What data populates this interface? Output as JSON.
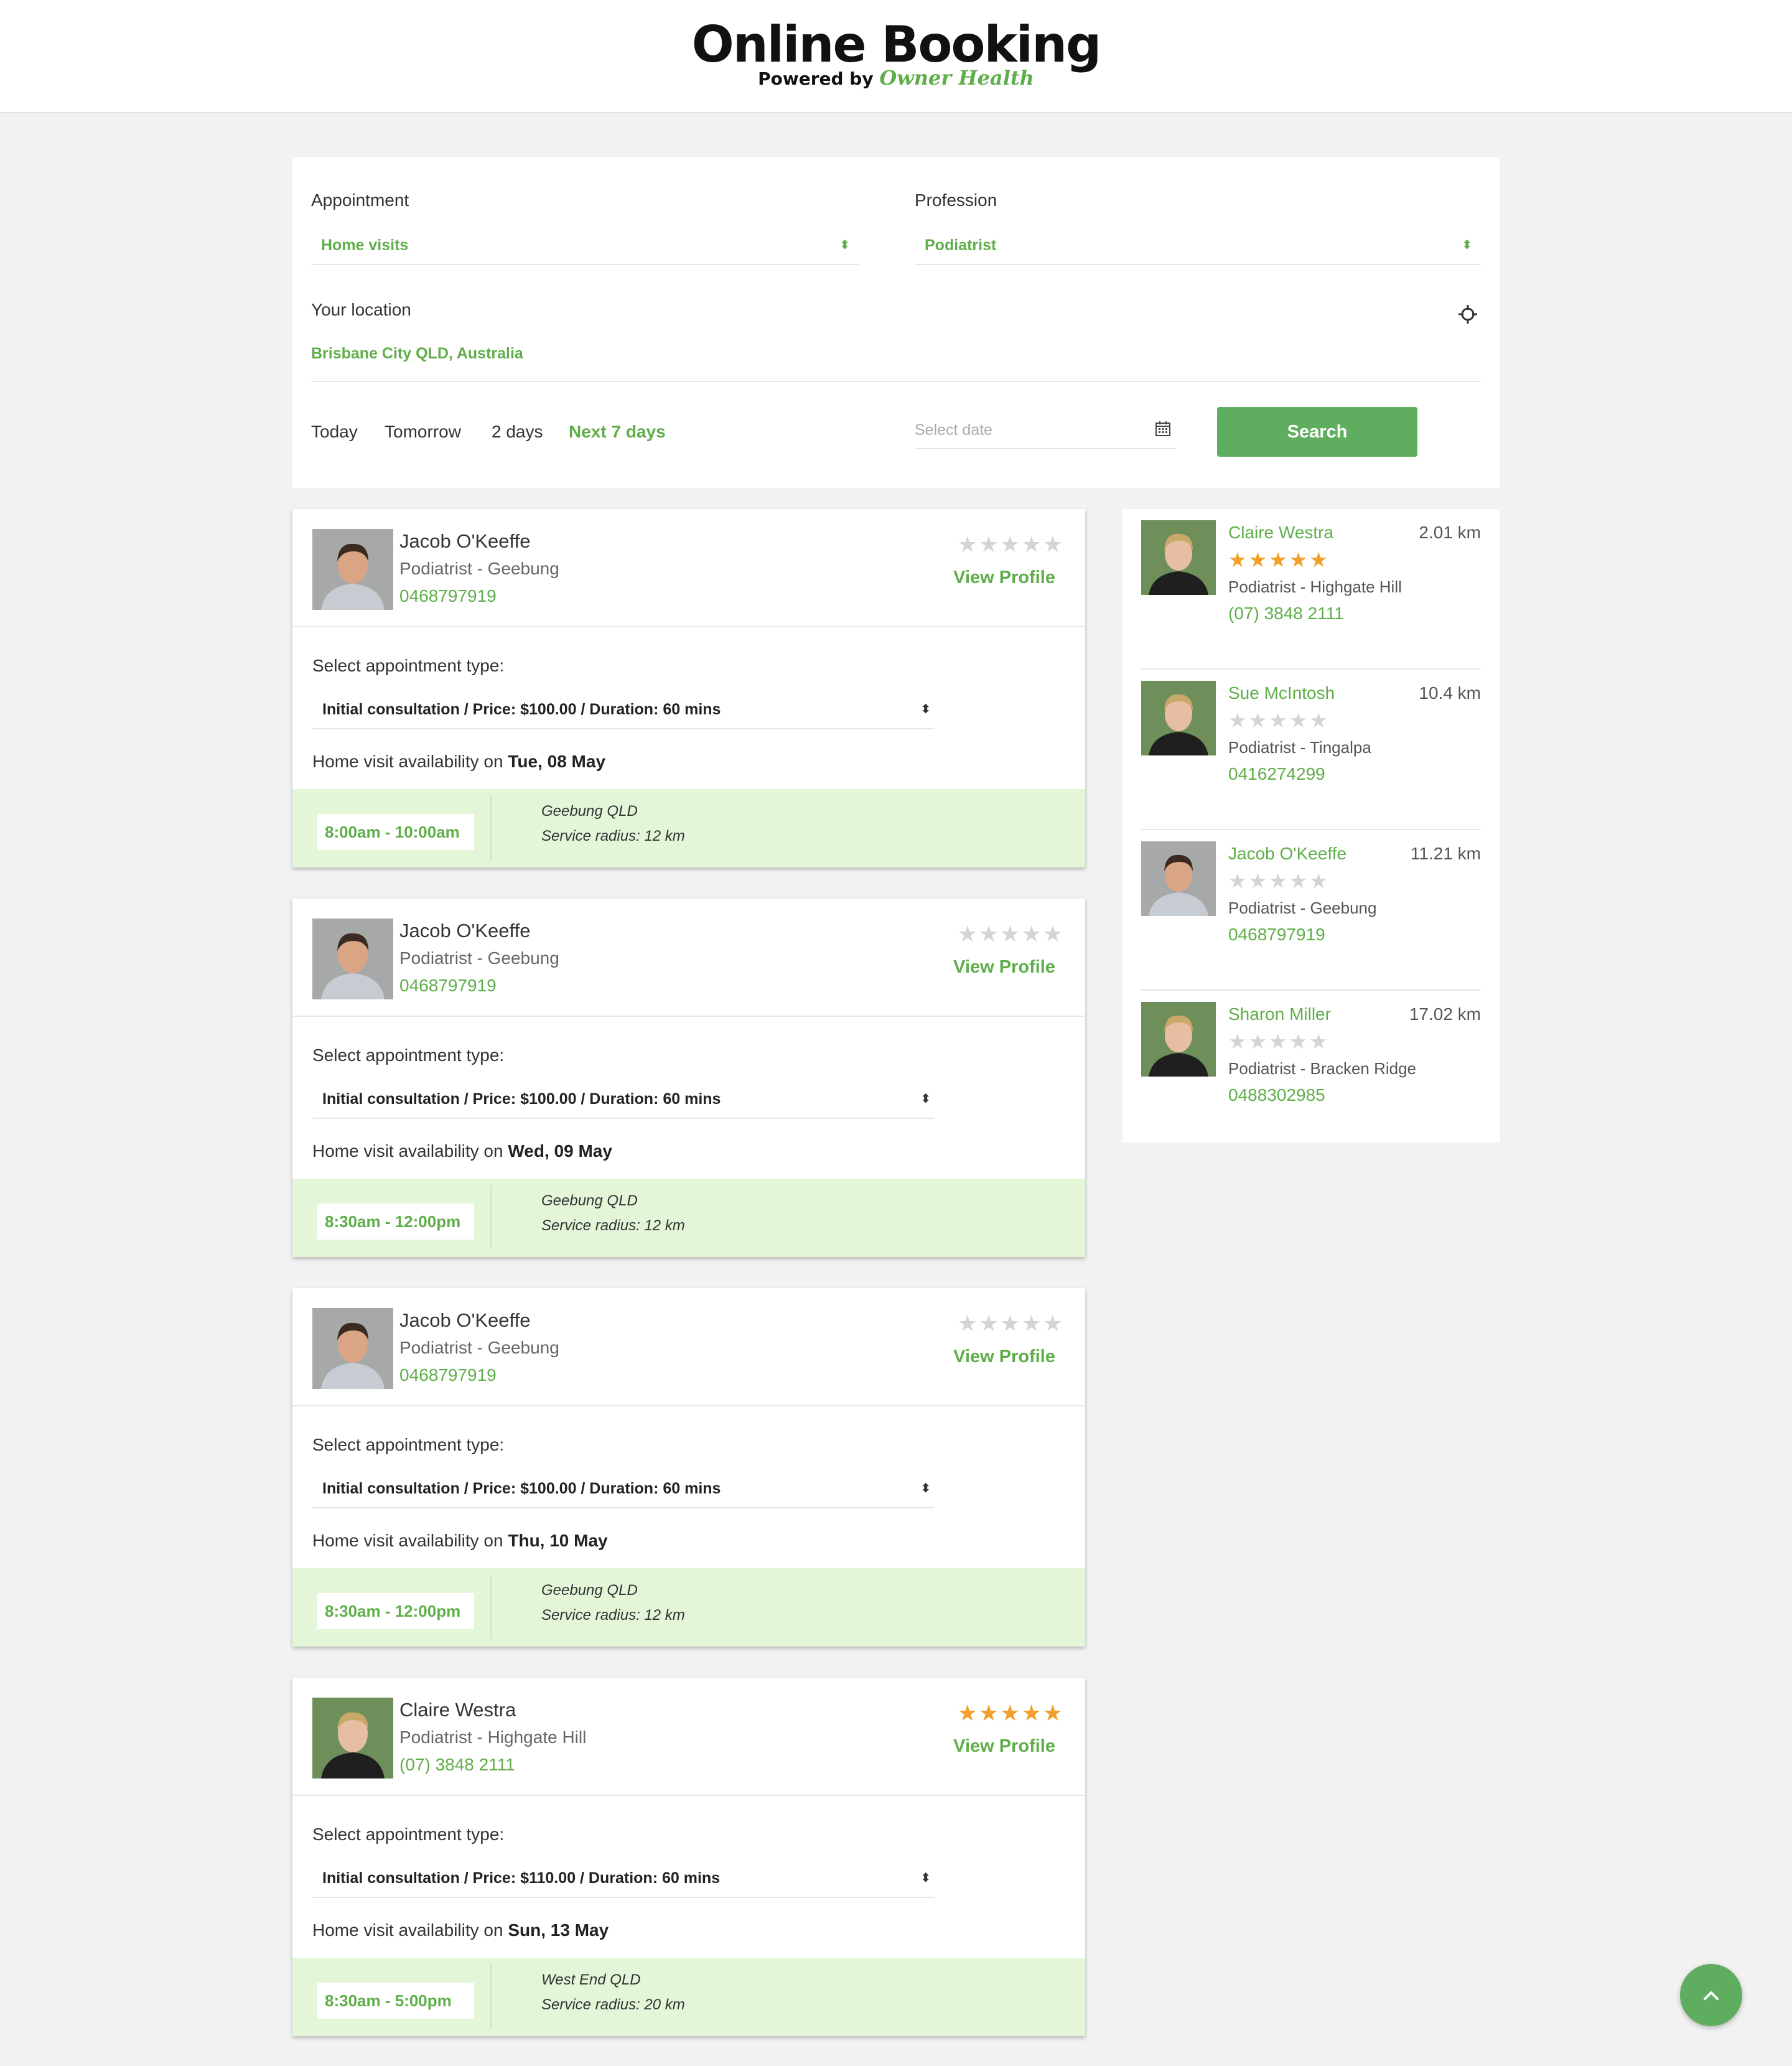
{
  "header": {
    "title": "Online Booking",
    "powered_by": "Powered by",
    "brand": "Owner Health"
  },
  "search": {
    "appointment_label": "Appointment",
    "appointment_value": "Home visits",
    "profession_label": "Profession",
    "profession_value": "Podiatrist",
    "location_label": "Your location",
    "location_value": "Brisbane City QLD, Australia",
    "ranges": [
      "Today",
      "Tomorrow",
      "2 days",
      "Next 7 days"
    ],
    "active_range": "Next 7 days",
    "date_placeholder": "Select date",
    "search_button": "Search"
  },
  "colors": {
    "accent": "#5fae4a",
    "button": "#5fae5f",
    "slot_band": "#e3f6d8",
    "star_on": "#f2a02b",
    "star_off": "#d4d4d4"
  },
  "results": [
    {
      "name": "Jacob O'Keeffe",
      "subtitle": "Podiatrist - Geebung",
      "phone": "0468797919",
      "rating": 0,
      "view_profile": "View Profile",
      "appt_label": "Select appointment type:",
      "appt_type": "Initial consultation / Price: $100.00 / Duration: 60 mins",
      "availability_prefix": "Home visit availability on",
      "availability_date": "Tue, 08 May",
      "slot": "8:00am - 10:00am",
      "area": "Geebung QLD",
      "radius": "Service radius: 12 km"
    },
    {
      "name": "Jacob O'Keeffe",
      "subtitle": "Podiatrist - Geebung",
      "phone": "0468797919",
      "rating": 0,
      "view_profile": "View Profile",
      "appt_label": "Select appointment type:",
      "appt_type": "Initial consultation / Price: $100.00 / Duration: 60 mins",
      "availability_prefix": "Home visit availability on",
      "availability_date": "Wed, 09 May",
      "slot": "8:30am - 12:00pm",
      "area": "Geebung QLD",
      "radius": "Service radius: 12 km"
    },
    {
      "name": "Jacob O'Keeffe",
      "subtitle": "Podiatrist - Geebung",
      "phone": "0468797919",
      "rating": 0,
      "view_profile": "View Profile",
      "appt_label": "Select appointment type:",
      "appt_type": "Initial consultation / Price: $100.00 / Duration: 60 mins",
      "availability_prefix": "Home visit availability on",
      "availability_date": "Thu, 10 May",
      "slot": "8:30am - 12:00pm",
      "area": "Geebung QLD",
      "radius": "Service radius: 12 km"
    },
    {
      "name": "Claire Westra",
      "subtitle": "Podiatrist - Highgate Hill",
      "phone": "(07) 3848 2111",
      "rating": 5,
      "view_profile": "View Profile",
      "appt_label": "Select appointment type:",
      "appt_type": "Initial consultation / Price: $110.00 / Duration: 60 mins",
      "availability_prefix": "Home visit availability on",
      "availability_date": "Sun, 13 May",
      "slot": "8:30am - 5:00pm",
      "area": "West End QLD",
      "radius": "Service radius: 20 km"
    }
  ],
  "nearby": [
    {
      "name": "Claire Westra",
      "distance": "2.01 km",
      "rating": 5,
      "subtitle": "Podiatrist - Highgate Hill",
      "phone": "(07) 3848 2111"
    },
    {
      "name": "Sue McIntosh",
      "distance": "10.4 km",
      "rating": 0,
      "subtitle": "Podiatrist - Tingalpa",
      "phone": "0416274299"
    },
    {
      "name": "Jacob O'Keeffe",
      "distance": "11.21 km",
      "rating": 0,
      "subtitle": "Podiatrist - Geebung",
      "phone": "0468797919"
    },
    {
      "name": "Sharon Miller",
      "distance": "17.02 km",
      "rating": 0,
      "subtitle": "Podiatrist - Bracken Ridge",
      "phone": "0488302985"
    }
  ],
  "icons": {
    "select": "updown-arrows-icon",
    "location": "crosshair-icon",
    "calendar": "calendar-icon",
    "scroll_top": "chevron-up-icon",
    "star": "star-icon"
  }
}
